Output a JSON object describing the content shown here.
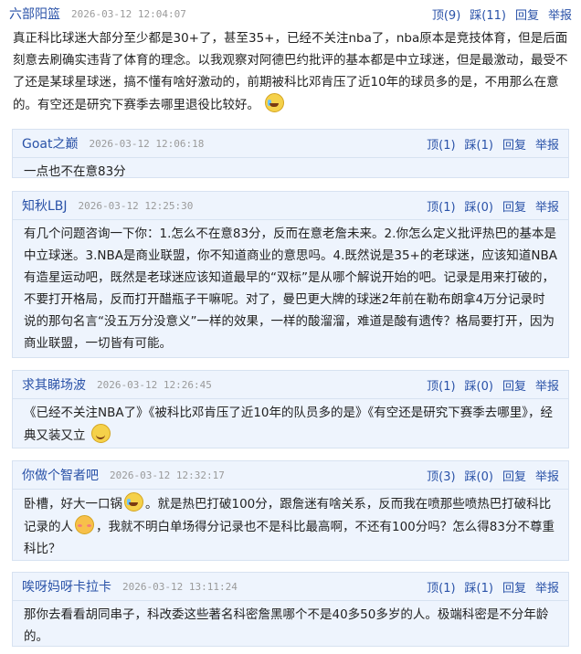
{
  "main_post": {
    "username": "六部阳篮",
    "timestamp": "2026-03-12 12:04:07",
    "actions": {
      "top": "顶(9)",
      "down": "踩(11)",
      "reply": "回复",
      "report": "举报"
    },
    "text": "真正科比球迷大部分至少都是30+了，甚至35+，已经不关注nba了，nba原本是竞技体育，但是后面刻意去刷确实违背了体育的理念。以我观察对阿德巴约批评的基本都是中立球迷，但是最激动，最受不了还是某球星球迷，搞不懂有啥好激动的，前期被科比邓肯压了近10年的球员多的是，不用那么在意的。有空还是研究下赛季去哪里退役比较好。",
    "emoji": "crying-face-emoji"
  },
  "replies": [
    {
      "username": "Goat之巅",
      "timestamp": "2026-03-12 12:06:18",
      "actions": {
        "top": "顶(1)",
        "down": "踩(1)",
        "reply": "回复",
        "report": "举报"
      },
      "text": "一点也不在意83分"
    },
    {
      "username": "知秋LBJ",
      "timestamp": "2026-03-12 12:25:30",
      "actions": {
        "top": "顶(1)",
        "down": "踩(0)",
        "reply": "回复",
        "report": "举报"
      },
      "text": "有几个问题咨询一下你：1.怎么不在意83分，反而在意老詹未来。2.你怎么定义批评热巴的基本是中立球迷。3.NBA是商业联盟，你不知道商业的意思吗。4.既然说是35+的老球迷，应该知道NBA有造星运动吧，既然是老球迷应该知道最早的“双标”是从哪个解说开始的吧。记录是用来打破的，不要打开格局，反而打开醋瓶子干嘛呢。对了，曼巴更大牌的球迷2年前在勒布朗拿4万分记录时说的那句名言“没五万分没意义”一样的效果，一样的酸溜溜，难道是酸有遗传？格局要打开，因为商业联盟，一切皆有可能。"
    },
    {
      "username": "求其睇场波",
      "timestamp": "2026-03-12 12:26:45",
      "actions": {
        "top": "顶(1)",
        "down": "踩(0)",
        "reply": "回复",
        "report": "举报"
      },
      "text": "《已经不关注NBA了》《被科比邓肯压了近10年的队员多的是》《有空还是研究下赛季去哪里》，经典又装又立",
      "emoji": "smirk-emoji"
    },
    {
      "username": "你做个智者吧",
      "timestamp": "2026-03-12 12:32:17",
      "actions": {
        "top": "顶(3)",
        "down": "踩(0)",
        "reply": "回复",
        "report": "举报"
      },
      "text_a": "卧槽，好大一口锅",
      "emoji_a": "crying-face-emoji",
      "text_b": "。就是热巴打破100分，跟詹迷有啥关系，反而我在喷那些喷热巴打破科比记录的人",
      "emoji_b": "shy-face-emoji",
      "text_c": "，我就不明白单场得分记录也不是科比最高啊，不还有100分吗？怎么得83分不尊重科比？"
    },
    {
      "username": "唉呀妈呀卡拉卡",
      "timestamp": "2026-03-12 13:11:24",
      "actions": {
        "top": "顶(1)",
        "down": "踩(1)",
        "reply": "回复",
        "report": "举报"
      },
      "text": "那你去看看胡同串子，科改委这些著名科密詹黑哪个不是40多50多岁的人。极端科密是不分年龄的。"
    }
  ]
}
